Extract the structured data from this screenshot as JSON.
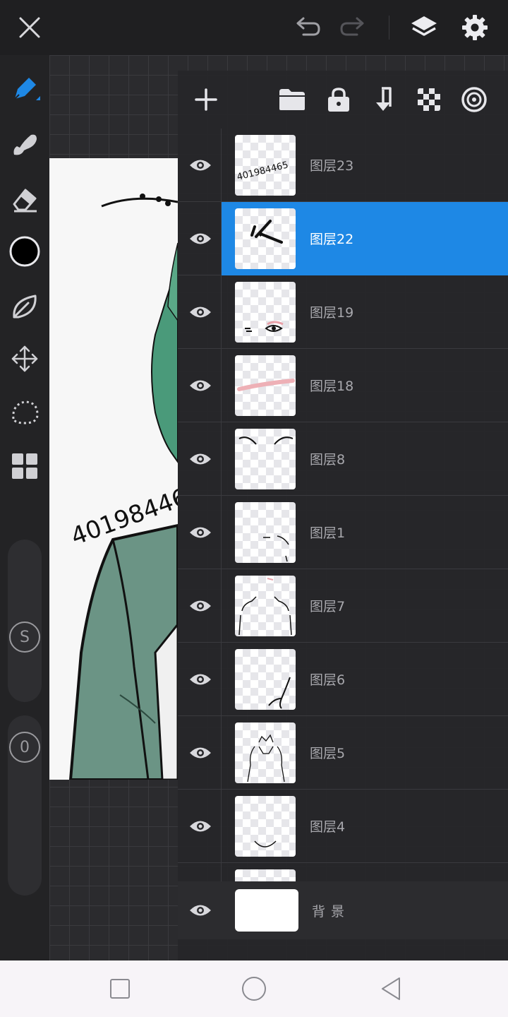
{
  "top_bar": {
    "close_icon": "close-icon",
    "undo_icon": "undo-icon",
    "redo_icon": "redo-icon",
    "layers_icon": "layers-icon",
    "settings_icon": "gear-icon"
  },
  "toolbar": {
    "tools": [
      "brush-icon",
      "smudge-icon",
      "eraser-icon",
      "color-swatch",
      "leaf-icon",
      "transform-icon",
      "lasso-icon",
      "grid-icon"
    ],
    "current_color": "#000000",
    "accent_color": "#1e88e5",
    "size_slider_label": "S",
    "opacity_slider_label": "0"
  },
  "artwork": {
    "watermark": "401984465"
  },
  "layers_panel": {
    "tools": [
      "add-layer-icon",
      "folder-icon",
      "lock-icon",
      "merge-down-icon",
      "checkerboard-icon",
      "target-icon"
    ],
    "layers": [
      {
        "name": "图层23",
        "thumb_text": "401984465",
        "visible": true,
        "selected": false
      },
      {
        "name": "图层22",
        "visible": true,
        "selected": true
      },
      {
        "name": "图层19",
        "visible": true,
        "selected": false
      },
      {
        "name": "图层18",
        "visible": true,
        "selected": false
      },
      {
        "name": "图层8",
        "visible": true,
        "selected": false
      },
      {
        "name": "图层1",
        "visible": true,
        "selected": false
      },
      {
        "name": "图层7",
        "visible": true,
        "selected": false
      },
      {
        "name": "图层6",
        "visible": true,
        "selected": false
      },
      {
        "name": "图层5",
        "visible": true,
        "selected": false
      },
      {
        "name": "图层4",
        "visible": true,
        "selected": false
      }
    ],
    "background_layer": {
      "name": "背景",
      "visible": true
    }
  },
  "nav_bar": {
    "recents_icon": "square-icon",
    "home_icon": "circle-icon",
    "back_icon": "triangle-back-icon"
  }
}
